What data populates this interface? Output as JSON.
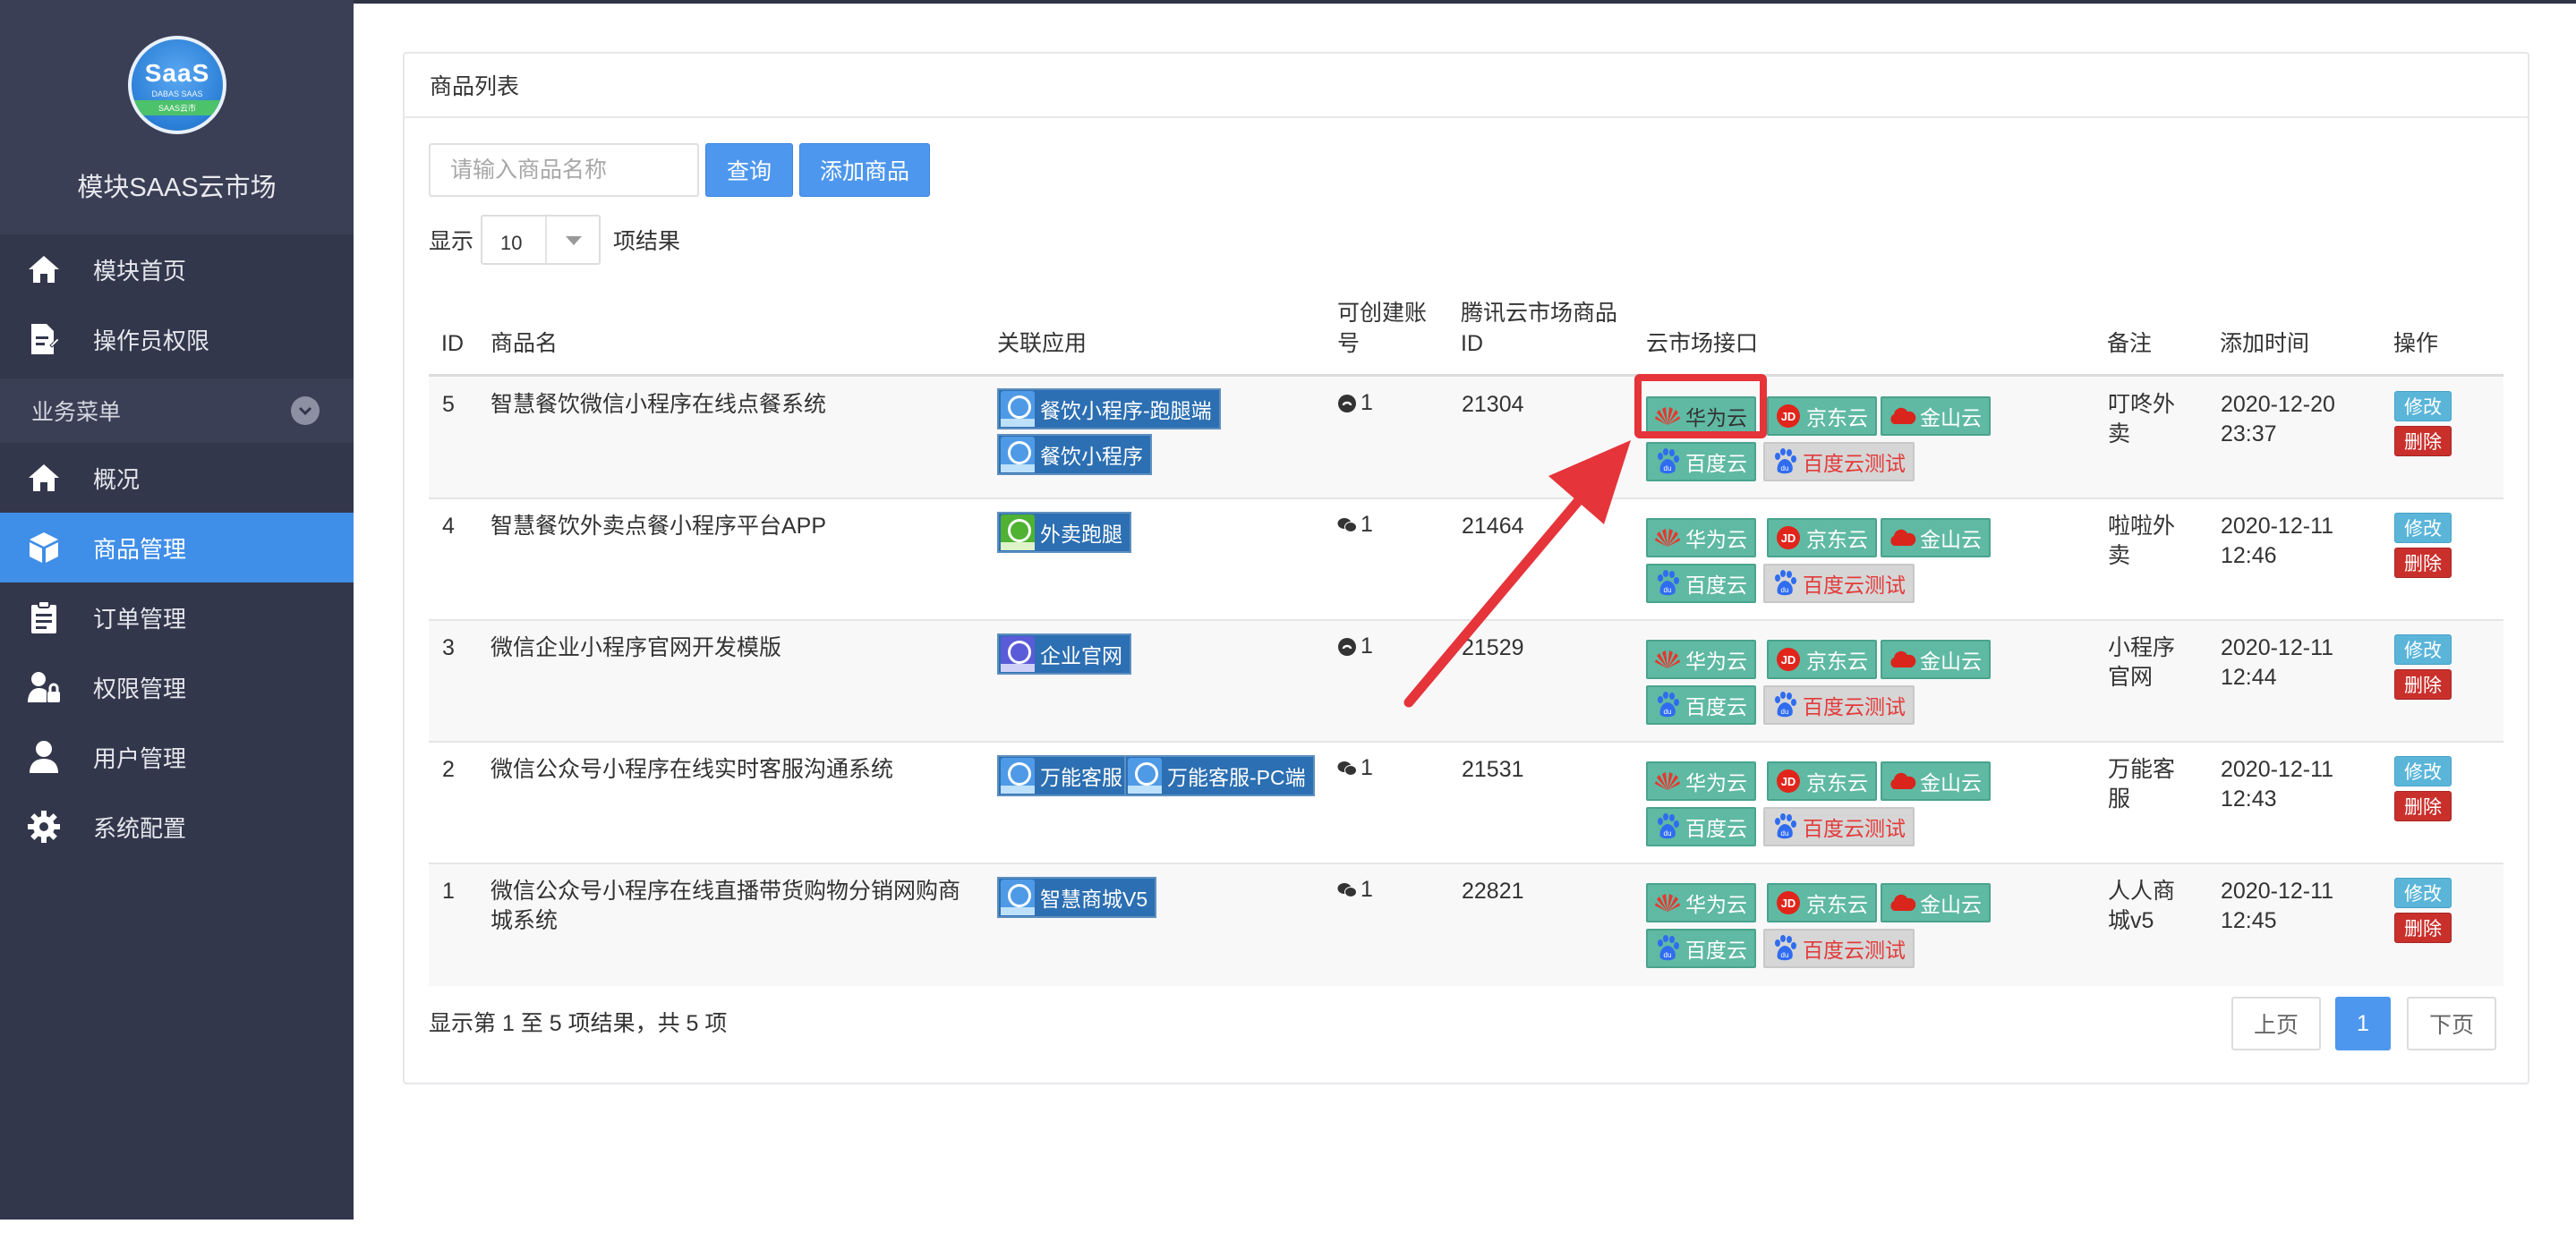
{
  "brand": {
    "logo_top": "SaaS",
    "logo_mid": "DABAS SAAS",
    "logo_bottom": "SAAS云市",
    "title": "模块SAAS云市场"
  },
  "nav": {
    "home": "模块首页",
    "operator": "操作员权限",
    "section": "业务菜单",
    "overview": "概况",
    "goods": "商品管理",
    "orders": "订单管理",
    "perm": "权限管理",
    "users": "用户管理",
    "config": "系统配置"
  },
  "panel": {
    "title": "商品列表"
  },
  "search": {
    "placeholder": "请输入商品名称",
    "query_label": "查询",
    "add_label": "添加商品"
  },
  "length": {
    "prefix": "显示",
    "value": "10",
    "suffix": "项结果"
  },
  "table": {
    "headers": {
      "id": "ID",
      "name": "商品名",
      "apps": "关联应用",
      "acct1": "可创建账",
      "acct2": "号",
      "tx1": "腾讯云市场商品",
      "tx2": "ID",
      "cloud": "云市场接口",
      "note": "备注",
      "time": "添加时间",
      "op": "操作"
    },
    "clouds": {
      "huawei": "华为云",
      "jd": "京东云",
      "kingsoft": "金山云",
      "baidu": "百度云",
      "baidu_test": "百度云测试"
    },
    "ops": {
      "edit": "修改",
      "del": "删除"
    },
    "rows": [
      {
        "id": "5",
        "name1": "智慧餐饮微信小程序在线点餐系统",
        "name2": "",
        "apps": [
          "餐饮小程序-跑腿端",
          "餐饮小程序"
        ],
        "acct": "1",
        "tx": "21304",
        "note1": "叮咚外",
        "note2": "卖",
        "date": "2020-12-20",
        "time": "23:37"
      },
      {
        "id": "4",
        "name1": "智慧餐饮外卖点餐小程序平台APP",
        "name2": "",
        "apps": [
          "外卖跑腿"
        ],
        "acct": "1",
        "tx": "21464",
        "note1": "啦啦外",
        "note2": "卖",
        "date": "2020-12-11",
        "time": "12:46"
      },
      {
        "id": "3",
        "name1": "微信企业小程序官网开发模版",
        "name2": "",
        "apps": [
          "企业官网"
        ],
        "acct": "1",
        "tx": "21529",
        "note1": "小程序",
        "note2": "官网",
        "date": "2020-12-11",
        "time": "12:44"
      },
      {
        "id": "2",
        "name1": "微信公众号小程序在线实时客服沟通系统",
        "name2": "",
        "apps": [
          "万能客服",
          "万能客服-PC端"
        ],
        "acct": "1",
        "tx": "21531",
        "note1": "万能客",
        "note2": "服",
        "date": "2020-12-11",
        "time": "12:43"
      },
      {
        "id": "1",
        "name1": "微信公众号小程序在线直播带货购物分销网购商",
        "name2": "城系统",
        "apps": [
          "智慧商城V5"
        ],
        "acct": "1",
        "tx": "22821",
        "note1": "人人商",
        "note2": "城v5",
        "date": "2020-12-11",
        "time": "12:45"
      }
    ]
  },
  "footer": {
    "info": "显示第 1 至 5 项结果，共 5 项",
    "prev": "上页",
    "page": "1",
    "next": "下页"
  }
}
